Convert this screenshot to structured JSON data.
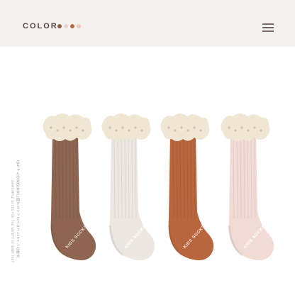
{
  "header": {
    "color_label": "COLOR",
    "swatches": [
      "#8c5e44",
      "#e8d6cf",
      "#b8693f",
      "#f0c9bd"
    ]
  },
  "caption": {
    "japanese": "赤ちゃんの足の安全に関するソックスロフトラインの晩点",
    "english": "GRIPSIMPLE SOCKS FOR THE SAFETY OF BABY FEET"
  },
  "socks": [
    {
      "color": "#8d6550",
      "cuff": "#8d6550",
      "brand": "KIDS SOCKS",
      "brand_color": "#e8d9cf",
      "lace": "#efe6d4"
    },
    {
      "color": "#ece8e1",
      "cuff": "#ece8e1",
      "brand": "KIDS SOCKS",
      "brand_color": "#ffffff",
      "lace": "#efe6d4"
    },
    {
      "color": "#b8663d",
      "cuff": "#b8663d",
      "brand": "KIDS SOCKS",
      "brand_color": "#f3e1d4",
      "lace": "#efe6d4"
    },
    {
      "color": "#f3dbd5",
      "cuff": "#f3dbd5",
      "brand": "KIDS SOCKS",
      "brand_color": "#ffffff",
      "lace": "#efe6d4"
    }
  ]
}
